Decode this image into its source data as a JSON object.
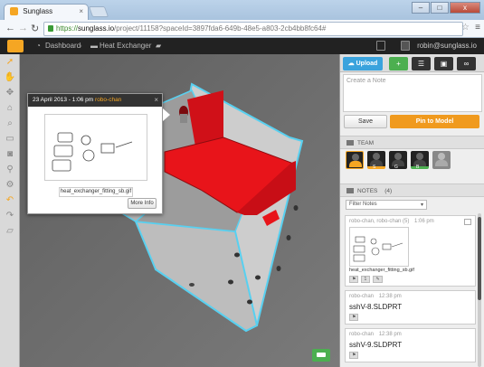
{
  "browser": {
    "tab_title": "Sunglass",
    "tab_close": "×",
    "url_scheme": "https://",
    "url_host": "sunglass.io",
    "url_path": "/project/11158?spaceId=3897fda6-649b-48e5-a803-2cb4bb8fc64#",
    "window_buttons": {
      "minimize": "–",
      "maximize": "□",
      "close": "x"
    }
  },
  "header": {
    "dashboard_label": "Dashboard",
    "project_label": "Heat Exchanger",
    "user_email": "robin@sunglass.io"
  },
  "left_toolbar": {
    "tools": [
      "select-arrow-icon",
      "hand-pan-icon",
      "move-icon",
      "home-icon",
      "search-icon",
      "comment-icon",
      "camera-icon",
      "zoom-icon",
      "settings-gear-icon",
      "undo-icon",
      "redo-icon",
      "measure-ruler-icon"
    ]
  },
  "popup": {
    "date": "23 April 2013 - 1:06 pm",
    "user": "robo-chan",
    "close": "×",
    "filename": "heat_exchanger_fitting_sb.gif",
    "more_info": "More Info"
  },
  "right_panel": {
    "upload_label": "Upload",
    "note_placeholder": "Create a Note",
    "save_label": "Save",
    "pin_label": "Pin to Model",
    "team_header": "TEAM",
    "team_members": [
      "S",
      "G",
      "B"
    ],
    "notes_header": "NOTES",
    "notes_count": "(4)",
    "filter_label": "Filter Notes",
    "notes": [
      {
        "user": "robo-chan, robo-chan (5)",
        "time": "1:06 pm",
        "file": "heat_exchanger_fitting_sb.gif",
        "count": "1"
      },
      {
        "user": "robo-chan",
        "time": "12:38 pm",
        "title": "sshV-8.SLDPRT"
      },
      {
        "user": "robo-chan",
        "time": "12:38 pm",
        "title": "sshV-9.SLDPRT"
      }
    ]
  },
  "colors": {
    "accent": "#f09a1e",
    "upload": "#3aa3dd",
    "part_red": "#e8141a",
    "selection_outline": "#58d0f0"
  }
}
